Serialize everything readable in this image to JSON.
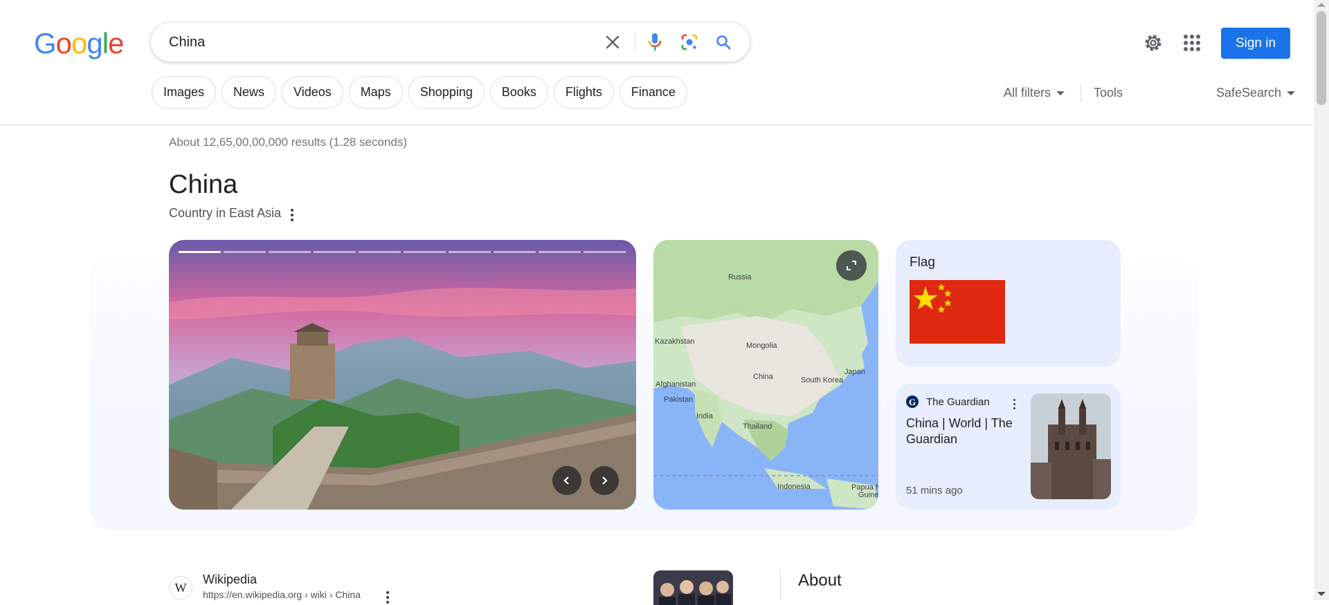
{
  "logo": {
    "letters": [
      "G",
      "o",
      "o",
      "g",
      "l",
      "e"
    ],
    "colors": [
      "#4285F4",
      "#EA4335",
      "#FBBC05",
      "#4285F4",
      "#34A853",
      "#EA4335"
    ]
  },
  "search": {
    "query": "China",
    "clear_icon": "close-icon",
    "voice_icon": "mic-icon",
    "lens_icon": "lens-icon",
    "search_icon": "search-icon"
  },
  "header": {
    "settings_icon": "gear-icon",
    "apps_icon": "apps-grid-icon",
    "signin_label": "Sign in",
    "accent": "#1a73e8"
  },
  "chips": [
    "Images",
    "News",
    "Videos",
    "Maps",
    "Shopping",
    "Books",
    "Flights",
    "Finance"
  ],
  "tools": {
    "all_filters": "All filters",
    "tools": "Tools",
    "safesearch": "SafeSearch"
  },
  "results_count": "About 12,65,00,00,000 results (1.28 seconds)",
  "entity": {
    "title": "China",
    "subtitle": "Country in East Asia"
  },
  "map_labels": [
    "Russia",
    "Kazakhstan",
    "Mongolia",
    "Afghanistan",
    "China",
    "Japan",
    "South Korea",
    "Pakistan",
    "India",
    "Thailand",
    "Indonesia",
    "Papua N",
    "Guine"
  ],
  "flag_card": {
    "label": "Flag"
  },
  "news_card": {
    "source": "The Guardian",
    "title": "China | World | The Guardian",
    "time": "51 mins ago"
  },
  "wikipedia": {
    "name": "Wikipedia",
    "url": "https://en.wikipedia.org › wiki › China",
    "icon_letter": "W"
  },
  "about": {
    "title": "About"
  }
}
